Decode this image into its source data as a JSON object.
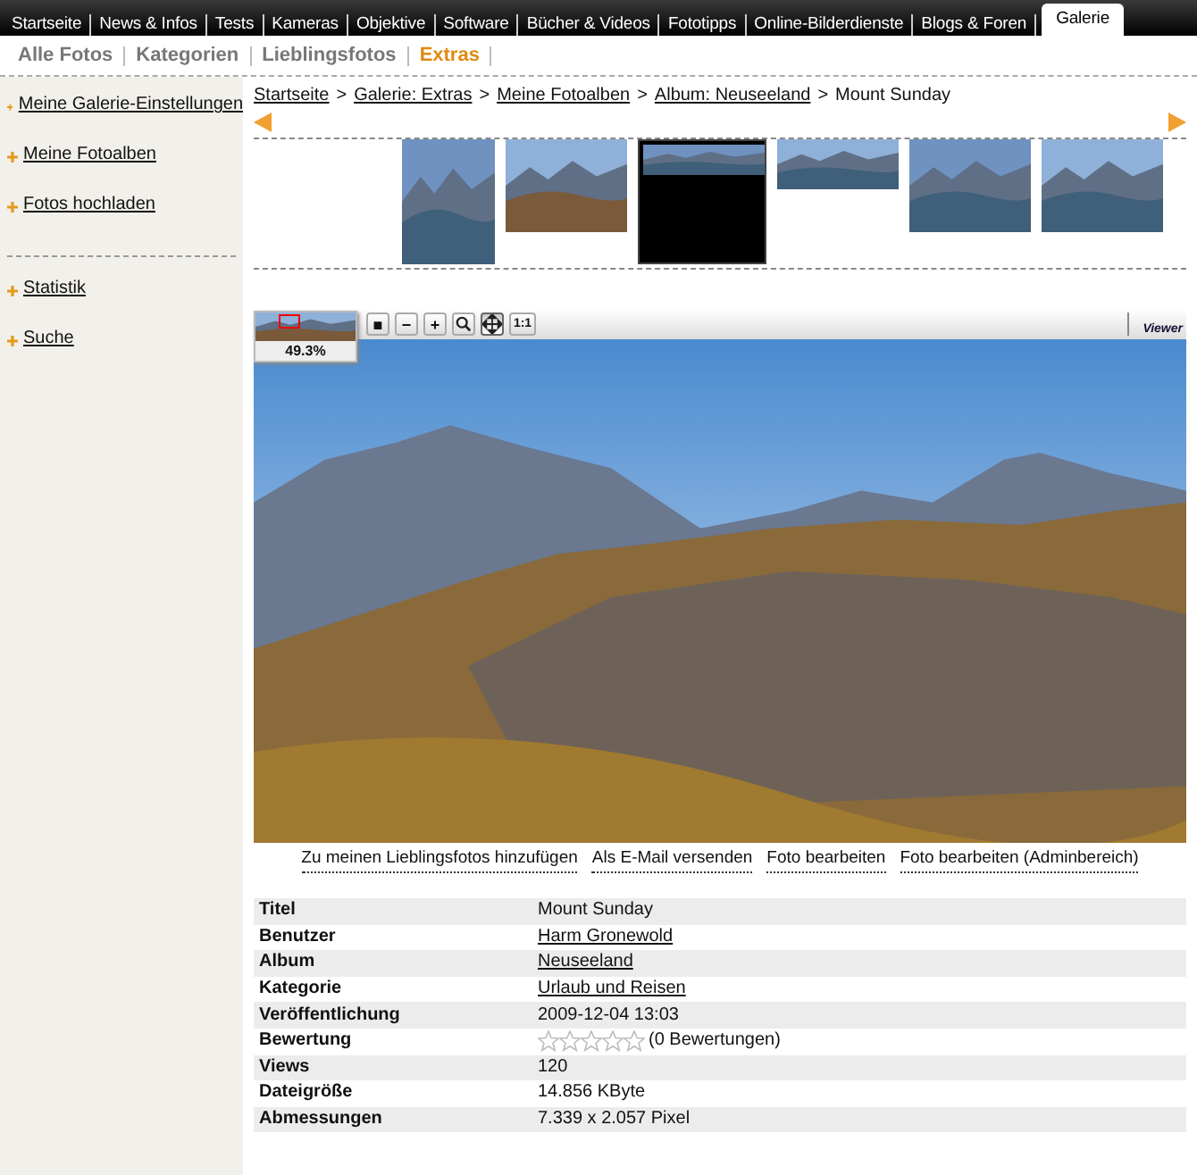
{
  "top_nav": [
    {
      "label": "Startseite",
      "selected": false
    },
    {
      "label": "News & Infos",
      "selected": false
    },
    {
      "label": "Tests",
      "selected": false
    },
    {
      "label": "Kameras",
      "selected": false
    },
    {
      "label": "Objektive",
      "selected": false
    },
    {
      "label": "Software",
      "selected": false
    },
    {
      "label": "Bücher & Videos",
      "selected": false
    },
    {
      "label": "Fototipps",
      "selected": false
    },
    {
      "label": "Online-Bilderdienste",
      "selected": false
    },
    {
      "label": "Blogs & Foren",
      "selected": false
    },
    {
      "label": "Galerie",
      "selected": true
    }
  ],
  "sub_nav": [
    {
      "label": "Alle Fotos",
      "selected": false
    },
    {
      "label": "Kategorien",
      "selected": false
    },
    {
      "label": "Lieblingsfotos",
      "selected": false
    },
    {
      "label": "Extras",
      "selected": true
    }
  ],
  "sidebar": {
    "groups": [
      [
        "Meine Galerie-Einstellungen",
        "Meine Fotoalben",
        "Fotos hochladen"
      ],
      [
        "Statistik",
        "Suche"
      ]
    ]
  },
  "breadcrumb": [
    {
      "label": "Startseite",
      "kind": "link"
    },
    {
      "label": ">",
      "kind": "separator"
    },
    {
      "label": "Galerie: Extras",
      "kind": "link"
    },
    {
      "label": ">",
      "kind": "separator"
    },
    {
      "label": "Meine Fotoalben",
      "kind": "link"
    },
    {
      "label": ">",
      "kind": "separator"
    },
    {
      "label": "Album: Neuseeland",
      "kind": "link"
    },
    {
      "label": ">",
      "kind": "separator"
    },
    {
      "label": "Mount Sunday",
      "kind": "current"
    }
  ],
  "thumbnails": [
    {
      "kind": "portrait",
      "selected": false
    },
    {
      "kind": "landscape",
      "selected": false
    },
    {
      "kind": "panorama",
      "selected": true
    },
    {
      "kind": "panorama",
      "selected": false
    },
    {
      "kind": "landscape",
      "selected": false
    },
    {
      "kind": "landscape",
      "selected": false
    }
  ],
  "viewer": {
    "zoom_reading": "49.3%",
    "logo": "Viewer",
    "tools": [
      {
        "kind": "glyph",
        "label": "■",
        "selected": false
      },
      {
        "kind": "glyph",
        "label": "−",
        "selected": false
      },
      {
        "kind": "glyph",
        "label": "+",
        "selected": false
      },
      {
        "kind": "magnifier",
        "selected": false
      },
      {
        "kind": "move",
        "selected": true
      },
      {
        "kind": "glyph",
        "label": "1:1",
        "selected": false
      }
    ]
  },
  "actions": [
    "Zu meinen Lieblingsfotos hinzufügen",
    "Als E-Mail versenden",
    "Foto bearbeiten",
    "Foto bearbeiten (Adminbereich)"
  ],
  "details": [
    {
      "label": "Titel",
      "kind": "text",
      "value": "Mount Sunday"
    },
    {
      "label": "Benutzer",
      "kind": "link",
      "value": "Harm Gronewold"
    },
    {
      "label": "Album",
      "kind": "link",
      "value": "Neuseeland"
    },
    {
      "label": "Kategorie",
      "kind": "link",
      "value": "Urlaub und Reisen"
    },
    {
      "label": "Veröffentlichung",
      "kind": "text",
      "value": "2009-12-04 13:03"
    },
    {
      "label": "Bewertung",
      "kind": "rating",
      "stars": 0,
      "value": "(0 Bewertungen)"
    },
    {
      "label": "Views",
      "kind": "text",
      "value": "120"
    },
    {
      "label": "Dateigröße",
      "kind": "text",
      "value": "14.856 KByte"
    },
    {
      "label": "Abmessungen",
      "kind": "text",
      "value": "7.339 x 2.057 Pixel"
    }
  ]
}
